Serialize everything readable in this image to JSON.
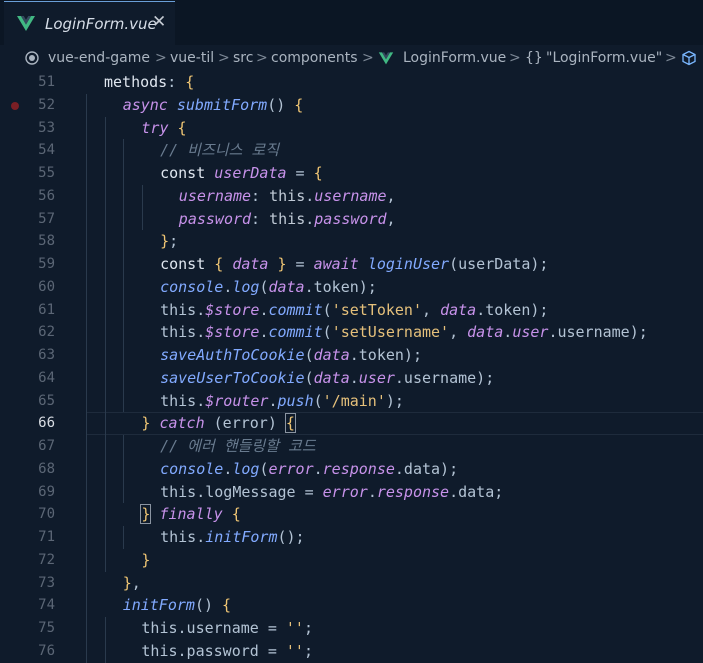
{
  "tab": {
    "label": "LoginForm.vue",
    "close": "✕",
    "accent": "#41b883"
  },
  "breadcrumb": {
    "items": [
      "vue-end-game",
      "vue-til",
      "src",
      "components",
      "LoginForm.vue",
      "\"LoginForm.vue\""
    ],
    "sep": ">"
  },
  "editor": {
    "active_line": 66,
    "breakpoint_line": 52,
    "lines": [
      {
        "n": "51",
        "indent": 0,
        "t": [
          [
            "p",
            "methods"
          ],
          [
            "u",
            ": "
          ],
          [
            "b",
            "{"
          ]
        ]
      },
      {
        "n": "52",
        "indent": 1,
        "t": [
          [
            "k",
            "async "
          ],
          [
            "f",
            "submitForm"
          ],
          [
            "u",
            "() "
          ],
          [
            "b",
            "{"
          ]
        ]
      },
      {
        "n": "53",
        "indent": 2,
        "t": [
          [
            "k",
            "try "
          ],
          [
            "b",
            "{"
          ]
        ]
      },
      {
        "n": "54",
        "indent": 3,
        "t": [
          [
            "c",
            "// 비즈니스 로직"
          ]
        ]
      },
      {
        "n": "55",
        "indent": 3,
        "t": [
          [
            "p",
            "const "
          ],
          [
            "v",
            "userData"
          ],
          [
            "u",
            " = "
          ],
          [
            "b",
            "{"
          ]
        ]
      },
      {
        "n": "56",
        "indent": 4,
        "t": [
          [
            "v",
            "username"
          ],
          [
            "u",
            ": "
          ],
          [
            "i",
            "this"
          ],
          [
            "u",
            "."
          ],
          [
            "v",
            "username"
          ],
          [
            "u",
            ","
          ]
        ]
      },
      {
        "n": "57",
        "indent": 4,
        "t": [
          [
            "v",
            "password"
          ],
          [
            "u",
            ": "
          ],
          [
            "i",
            "this"
          ],
          [
            "u",
            "."
          ],
          [
            "v",
            "password"
          ],
          [
            "u",
            ","
          ]
        ]
      },
      {
        "n": "58",
        "indent": 3,
        "t": [
          [
            "b",
            "}"
          ],
          [
            "u",
            ";"
          ]
        ]
      },
      {
        "n": "59",
        "indent": 3,
        "t": [
          [
            "p",
            "const "
          ],
          [
            "b",
            "{ "
          ],
          [
            "v",
            "data"
          ],
          [
            "b",
            " }"
          ],
          [
            "u",
            " = "
          ],
          [
            "k",
            "await "
          ],
          [
            "f",
            "loginUser"
          ],
          [
            "u",
            "(userData);"
          ]
        ]
      },
      {
        "n": "60",
        "indent": 3,
        "t": [
          [
            "f",
            "console"
          ],
          [
            "u",
            "."
          ],
          [
            "f",
            "log"
          ],
          [
            "u",
            "("
          ],
          [
            "v",
            "data"
          ],
          [
            "u",
            ".token);"
          ]
        ]
      },
      {
        "n": "61",
        "indent": 3,
        "t": [
          [
            "u",
            "this."
          ],
          [
            "v",
            "$store"
          ],
          [
            "u",
            "."
          ],
          [
            "f",
            "commit"
          ],
          [
            "u",
            "("
          ],
          [
            "s",
            "'setToken'"
          ],
          [
            "u",
            ", "
          ],
          [
            "v",
            "data"
          ],
          [
            "u",
            ".token);"
          ]
        ]
      },
      {
        "n": "62",
        "indent": 3,
        "t": [
          [
            "u",
            "this."
          ],
          [
            "v",
            "$store"
          ],
          [
            "u",
            "."
          ],
          [
            "f",
            "commit"
          ],
          [
            "u",
            "("
          ],
          [
            "s",
            "'setUsername'"
          ],
          [
            "u",
            ", "
          ],
          [
            "v",
            "data"
          ],
          [
            "u",
            "."
          ],
          [
            "v",
            "user"
          ],
          [
            "u",
            ".username);"
          ]
        ]
      },
      {
        "n": "63",
        "indent": 3,
        "t": [
          [
            "f",
            "saveAuthToCookie"
          ],
          [
            "u",
            "("
          ],
          [
            "v",
            "data"
          ],
          [
            "u",
            ".token);"
          ]
        ]
      },
      {
        "n": "64",
        "indent": 3,
        "t": [
          [
            "f",
            "saveUserToCookie"
          ],
          [
            "u",
            "("
          ],
          [
            "v",
            "data"
          ],
          [
            "u",
            "."
          ],
          [
            "v",
            "user"
          ],
          [
            "u",
            ".username);"
          ]
        ]
      },
      {
        "n": "65",
        "indent": 3,
        "t": [
          [
            "u",
            "this."
          ],
          [
            "v",
            "$router"
          ],
          [
            "u",
            "."
          ],
          [
            "f",
            "push"
          ],
          [
            "u",
            "("
          ],
          [
            "s",
            "'/main'"
          ],
          [
            "u",
            ");"
          ]
        ]
      },
      {
        "n": "66",
        "indent": 2,
        "t": [
          [
            "b",
            "} "
          ],
          [
            "k",
            "catch "
          ],
          [
            "u",
            "(error) "
          ],
          [
            "x",
            "{"
          ]
        ]
      },
      {
        "n": "67",
        "indent": 3,
        "t": [
          [
            "c",
            "// 에러 핸들링할 코드"
          ]
        ]
      },
      {
        "n": "68",
        "indent": 3,
        "t": [
          [
            "f",
            "console"
          ],
          [
            "u",
            "."
          ],
          [
            "f",
            "log"
          ],
          [
            "u",
            "("
          ],
          [
            "v",
            "error"
          ],
          [
            "u",
            "."
          ],
          [
            "v",
            "response"
          ],
          [
            "u",
            ".data);"
          ]
        ]
      },
      {
        "n": "69",
        "indent": 3,
        "t": [
          [
            "u",
            "this.logMessage = "
          ],
          [
            "v",
            "error"
          ],
          [
            "u",
            "."
          ],
          [
            "v",
            "response"
          ],
          [
            "u",
            ".data;"
          ]
        ]
      },
      {
        "n": "70",
        "indent": 2,
        "t": [
          [
            "x",
            "}"
          ],
          [
            "u",
            " "
          ],
          [
            "k",
            "finally "
          ],
          [
            "b",
            "{"
          ]
        ]
      },
      {
        "n": "71",
        "indent": 3,
        "t": [
          [
            "u",
            "this."
          ],
          [
            "f",
            "initForm"
          ],
          [
            "u",
            "();"
          ]
        ]
      },
      {
        "n": "72",
        "indent": 2,
        "t": [
          [
            "b",
            "}"
          ]
        ]
      },
      {
        "n": "73",
        "indent": 1,
        "t": [
          [
            "b",
            "}"
          ],
          [
            "u",
            ","
          ]
        ]
      },
      {
        "n": "74",
        "indent": 1,
        "t": [
          [
            "f",
            "initForm"
          ],
          [
            "u",
            "() "
          ],
          [
            "b",
            "{"
          ]
        ]
      },
      {
        "n": "75",
        "indent": 2,
        "t": [
          [
            "u",
            "this.username = "
          ],
          [
            "s",
            "''"
          ],
          [
            "u",
            ";"
          ]
        ]
      },
      {
        "n": "76",
        "indent": 2,
        "t": [
          [
            "u",
            "this.password = "
          ],
          [
            "s",
            "''"
          ],
          [
            "u",
            ";"
          ]
        ]
      }
    ]
  }
}
